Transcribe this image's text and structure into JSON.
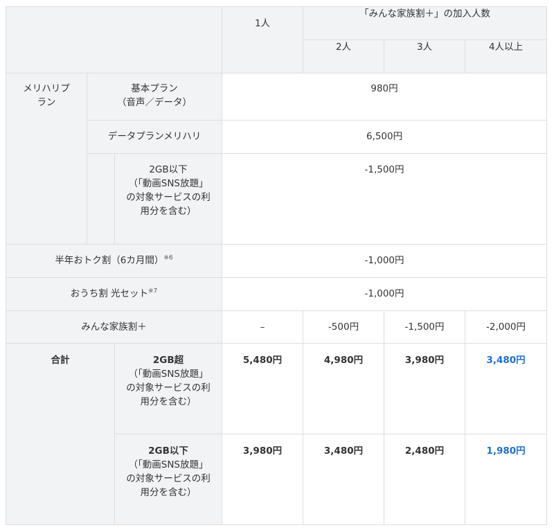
{
  "header": {
    "one_person": "1人",
    "family_title": "「みんな家族割＋」の加入人数",
    "two": "2人",
    "three": "3人",
    "four_plus": "4人以上"
  },
  "rows": {
    "merihari_label": "メリハリプラン",
    "basic_plan": "基本プラン\n（音声／データ）",
    "basic_price": "980円",
    "data_plan": "データプランメリハリ",
    "data_price": "6,500円",
    "under2gb_desc": "2GB以下\n（「動画SNS放題」の対象サービスの利用分を含む）",
    "under2gb_price": "-1,500円",
    "half_year": "半年おトク割（6カ月間）",
    "half_year_note": "※6",
    "half_year_price": "-1,000円",
    "ouchi": "おうち割 光セット",
    "ouchi_note": "※7",
    "ouchi_price": "-1,000円",
    "family_discount": "みんな家族割＋",
    "family_1": "–",
    "family_2": "-500円",
    "family_3": "-1,500円",
    "family_4": "-2,000円"
  },
  "total": {
    "label": "合計",
    "over2gb_title": "2GB超",
    "over2gb_desc": "（「動画SNS放題」の対象サービスの利用分を含む）",
    "over2gb_prices": [
      "5,480円",
      "4,980円",
      "3,980円",
      "3,480円"
    ],
    "under2gb_title": "2GB以下",
    "under2gb_desc": "（「動画SNS放題」の対象サービスの利用分を含む）",
    "under2gb_prices": [
      "3,980円",
      "3,480円",
      "2,480円",
      "1,980円"
    ]
  },
  "colors": {
    "accent_blue": "#1f6fd1",
    "header_gray": "#f2f3f5",
    "border": "#dddddd"
  }
}
